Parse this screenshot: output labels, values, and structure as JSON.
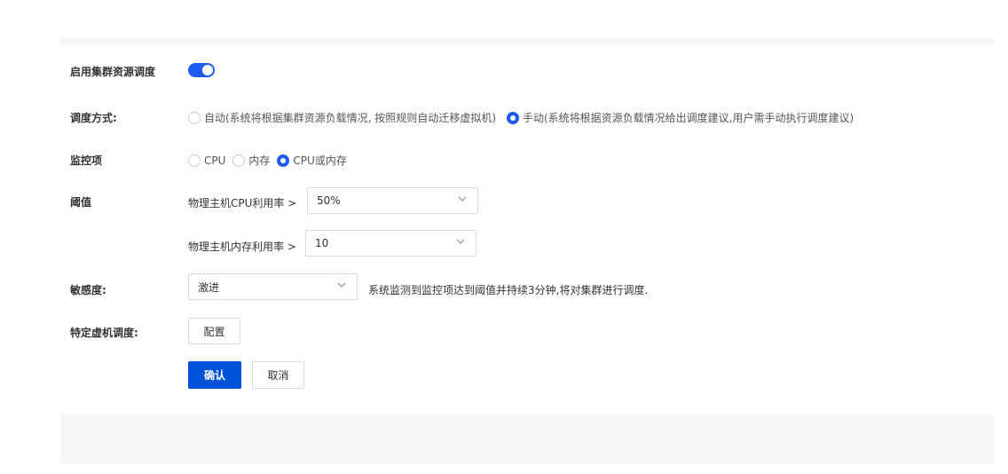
{
  "form": {
    "enable_label": "启用集群资源调度",
    "enable_on": true,
    "mode_label": "调度方式:",
    "mode_options": [
      {
        "label": "自动(系统将根据集群资源负载情况, 按照规则自动迁移虚拟机)",
        "checked": false
      },
      {
        "label": "手动(系统将根据资源负载情况给出调度建议,用户需手动执行调度建议)",
        "checked": true
      }
    ],
    "monitor_label": "监控项",
    "monitor_options": [
      {
        "label": "CPU",
        "checked": false
      },
      {
        "label": "内存",
        "checked": false
      },
      {
        "label": "CPU或内存",
        "checked": true
      }
    ],
    "threshold_label": "阈值",
    "cpu_prefix": "物理主机CPU利用率 >",
    "cpu_value": "50%",
    "mem_prefix": "物理主机内存利用率 >",
    "mem_value": "10",
    "sensitivity_label": "敏感度:",
    "sensitivity_value": "激进",
    "sensitivity_hint": "系统监测到监控项达到阈值并持续3分钟,将对集群进行调度.",
    "vm_label": "特定虚机调度:",
    "config_button": "配置",
    "confirm_button": "确认",
    "cancel_button": "取消"
  },
  "colors": {
    "primary": "#0052d9",
    "toggle": "#1d5bf0",
    "panel_bg": "#f5f6f8"
  },
  "icons": {
    "dropdown": "chevron-down-icon"
  }
}
